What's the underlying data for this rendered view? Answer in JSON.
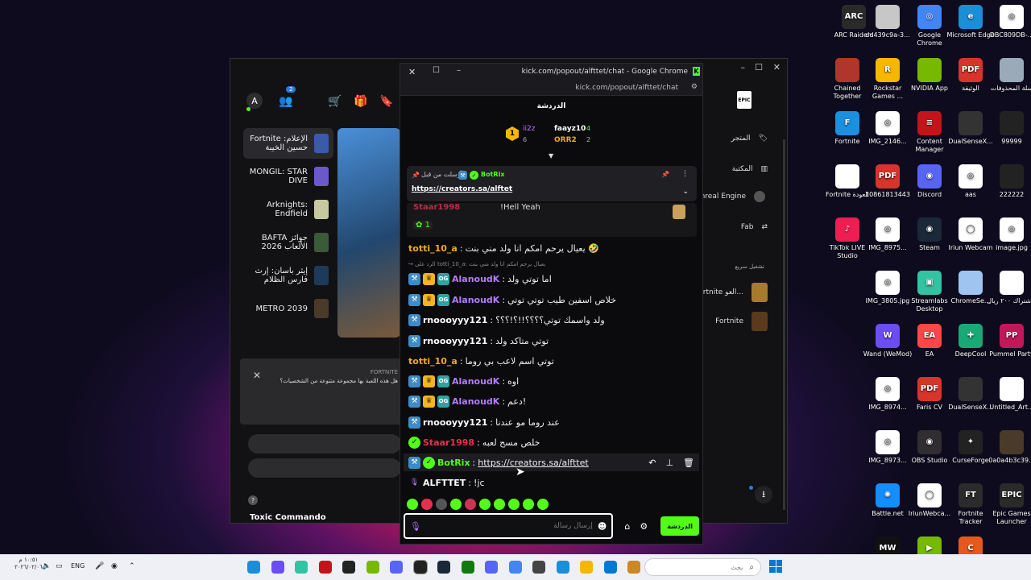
{
  "desktop_icons": [
    {
      "label": "ARC Raiders",
      "color": "#2a2a2a",
      "glyph": "ARC",
      "col": 1029,
      "row": 6
    },
    {
      "label": "dd439c9a-3...",
      "color": "#c7c7c7",
      "glyph": "",
      "col": 1071,
      "row": 6
    },
    {
      "label": "Google Chrome",
      "color": "#4285f4",
      "glyph": "◎",
      "col": 1123,
      "row": 6
    },
    {
      "label": "Microsoft Edge",
      "color": "#1a8fd8",
      "glyph": "e",
      "col": 1174,
      "row": 6
    },
    {
      "label": "DBC809DB-...",
      "color": "#ffffff",
      "glyph": "◎",
      "col": 1225,
      "row": 6
    },
    {
      "label": "Chained Together",
      "color": "#b0352a",
      "glyph": "",
      "col": 1021,
      "row": 72
    },
    {
      "label": "Rockstar Games ...",
      "color": "#f5b700",
      "glyph": "R",
      "col": 1071,
      "row": 72
    },
    {
      "label": "NVIDIA App",
      "color": "#76b900",
      "glyph": "",
      "col": 1123,
      "row": 72
    },
    {
      "label": "الوثيقة",
      "color": "#d9342b",
      "glyph": "PDF",
      "col": 1174,
      "row": 72
    },
    {
      "label": "سلة المحذوفات",
      "color": "#9aaab8",
      "glyph": "",
      "col": 1225,
      "row": 72
    },
    {
      "label": "Fortnite",
      "color": "#1b8fe0",
      "glyph": "F",
      "col": 1021,
      "row": 138
    },
    {
      "label": "IMG_2146...",
      "color": "#ffffff",
      "glyph": "◎",
      "col": 1071,
      "row": 138
    },
    {
      "label": "Content Manager",
      "color": "#c4141b",
      "glyph": "≡",
      "col": 1123,
      "row": 138
    },
    {
      "label": "DualSenseX...",
      "color": "#333333",
      "glyph": "",
      "col": 1174,
      "row": 138
    },
    {
      "label": "99999",
      "color": "#222222",
      "glyph": "",
      "col": 1225,
      "row": 138
    },
    {
      "label": "Fortnite العودة",
      "color": "#ffffff",
      "glyph": "",
      "col": 1021,
      "row": 204
    },
    {
      "label": "10861813443",
      "color": "#d9342b",
      "glyph": "PDF",
      "col": 1071,
      "row": 204
    },
    {
      "label": "Discord",
      "color": "#5865f2",
      "glyph": "◉",
      "col": 1123,
      "row": 204
    },
    {
      "label": "aas",
      "color": "#ffffff",
      "glyph": "◎",
      "col": 1174,
      "row": 204
    },
    {
      "label": "222222",
      "color": "#222222",
      "glyph": "",
      "col": 1225,
      "row": 204
    },
    {
      "label": "TikTok LIVE Studio",
      "color": "#ee1d52",
      "glyph": "♪",
      "col": 1021,
      "row": 270
    },
    {
      "label": "IMG_8975...",
      "color": "#ffffff",
      "glyph": "◎",
      "col": 1071,
      "row": 270
    },
    {
      "label": "Steam",
      "color": "#1b2838",
      "glyph": "◉",
      "col": 1123,
      "row": 270
    },
    {
      "label": "Iriun Webcam",
      "color": "#ffffff",
      "glyph": "◯",
      "col": 1174,
      "row": 270
    },
    {
      "label": "image.jpg",
      "color": "#ffffff",
      "glyph": "◎",
      "col": 1225,
      "row": 270
    },
    {
      "label": "IMG_3805.jpg",
      "color": "#ffffff",
      "glyph": "◎",
      "col": 1071,
      "row": 336
    },
    {
      "label": "Streamlabs Desktop",
      "color": "#31c3a2",
      "glyph": "▣",
      "col": 1123,
      "row": 336
    },
    {
      "label": "ChromeSe...",
      "color": "#9fc4f0",
      "glyph": "",
      "col": 1174,
      "row": 336
    },
    {
      "label": "الاشتراك ٢٠٠ ريال",
      "color": "#ffffff",
      "glyph": "",
      "col": 1225,
      "row": 336
    },
    {
      "label": "Wand (WeMod)",
      "color": "#6c4cf5",
      "glyph": "W",
      "col": 1071,
      "row": 402
    },
    {
      "label": "EA",
      "color": "#ff4747",
      "glyph": "EA",
      "col": 1123,
      "row": 402
    },
    {
      "label": "DeepCool",
      "color": "#19a974",
      "glyph": "✚",
      "col": 1174,
      "row": 402
    },
    {
      "label": "Pummel Party",
      "color": "#c2185b",
      "glyph": "PP",
      "col": 1225,
      "row": 402
    },
    {
      "label": "IMG_8974...",
      "color": "#ffffff",
      "glyph": "◎",
      "col": 1071,
      "row": 468
    },
    {
      "label": "Faris CV",
      "color": "#d9342b",
      "glyph": "PDF",
      "col": 1123,
      "row": 468
    },
    {
      "label": "DualSenseX...",
      "color": "#333333",
      "glyph": "",
      "col": 1174,
      "row": 468
    },
    {
      "label": "Untitled_Art...",
      "color": "#ffffff",
      "glyph": "",
      "col": 1225,
      "row": 468
    },
    {
      "label": "IMG_8973...",
      "color": "#ffffff",
      "glyph": "◎",
      "col": 1071,
      "row": 534
    },
    {
      "label": "OBS Studio",
      "color": "#302e31",
      "glyph": "◉",
      "col": 1123,
      "row": 534
    },
    {
      "label": "CurseForge",
      "color": "#222222",
      "glyph": "✦",
      "col": 1174,
      "row": 534
    },
    {
      "label": "0a0a4b3c39...",
      "color": "#4a3a2a",
      "glyph": "",
      "col": 1225,
      "row": 534
    },
    {
      "label": "Battle.net",
      "color": "#148eff",
      "glyph": "✺",
      "col": 1071,
      "row": 600
    },
    {
      "label": "IriunWebca...",
      "color": "#ffffff",
      "glyph": "◯",
      "col": 1123,
      "row": 600
    },
    {
      "label": "Fortnite Tracker",
      "color": "#2b2b2b",
      "glyph": "FT",
      "col": 1174,
      "row": 600
    },
    {
      "label": "Epic Games Launcher",
      "color": "#2a2a2a",
      "glyph": "EPIC",
      "col": 1225,
      "row": 600
    },
    {
      "label": "",
      "color": "#111111",
      "glyph": "MW",
      "col": 1071,
      "row": 666
    },
    {
      "label": "",
      "color": "#76b900",
      "glyph": "▶",
      "col": 1123,
      "row": 666
    },
    {
      "label": "",
      "color": "#e55a1c",
      "glyph": "C",
      "col": 1174,
      "row": 666
    }
  ],
  "epic": {
    "avatar": "A",
    "friends_count": "2",
    "library": [
      {
        "label": "Fortnite الإعلام: حسين الخيبة",
        "color": "#3b5aa8",
        "selected": true
      },
      {
        "label": "MONGIL: STAR DIVE",
        "color": "#6a5ac8",
        "selected": false
      },
      {
        "label": "Arknights: Endfield",
        "color": "#c9c9a0",
        "selected": false
      },
      {
        "label": "BAFTA جوائز الألعاب 2026",
        "color": "#3a5a3a",
        "selected": false
      },
      {
        "label": "إيثر باسان: إرث فارس الظلام",
        "color": "#1d3a5a",
        "selected": false
      },
      {
        "label": "METRO 2039",
        "color": "#4a3a2a",
        "selected": false
      }
    ],
    "nav": {
      "store": "المتجر",
      "library": "المكتبة",
      "unreal": "Unreal Engine",
      "fab": "Fab",
      "quick_launch": "تشغيل سريع"
    },
    "quick": [
      {
        "label": "Fortnite العو..."
      },
      {
        "label": "Fortnite"
      }
    ],
    "notification": {
      "brand": "FORTNITE",
      "text": "هل هذه اللعبة بها مجموعة متنوعة من الشخصيات؟"
    },
    "bottom_title": "Toxic Commando"
  },
  "chat": {
    "window_title": "kick.com/popout/alfttet/chat - Google Chrome",
    "url": "kick.com/popout/alfttet/chat",
    "header": "الدردشة",
    "leaderboard": [
      {
        "rank": "1",
        "name": "ii2z",
        "score": "6"
      },
      {
        "rank": "",
        "name": "faayz10",
        "score": "4"
      },
      {
        "rank": "",
        "name": "ORR2",
        "score": "2"
      }
    ],
    "pinned": {
      "author": "BotRix",
      "sent_by": "أرسلت من قبل",
      "link": "https://creators.sa/alftet"
    },
    "partial": {
      "name": "Staar1998",
      "text": "!Hell Yeah",
      "count": "1"
    },
    "messages": [
      {
        "badges": [],
        "user": "totti_10_a",
        "color": "#f5a524",
        "text": "يعيال يرحم امكم انا ولد مني بنت 🤣"
      },
      {
        "badges": [],
        "user": "",
        "color": "#888",
        "text": "↪ الرد على totti_10_a: يعيال يرحم امكم انا ولد مني بنت",
        "reply": true
      },
      {
        "badges": [
          "tool",
          "crown",
          "og"
        ],
        "user": "AlanoudK",
        "color": "#b57bff",
        "text": "اما توتي ولد"
      },
      {
        "badges": [
          "tool",
          "crown",
          "og"
        ],
        "user": "AlanoudK",
        "color": "#b57bff",
        "text": "خلاص اسفين طيب توتي توتي"
      },
      {
        "badges": [
          "tool"
        ],
        "user": "rnoooyyy121",
        "color": "#ffffff",
        "text": "ولد واسمك توتي؟؟؟؟!!؟!؟؟؟"
      },
      {
        "badges": [
          "tool"
        ],
        "user": "rnoooyyy121",
        "color": "#ffffff",
        "text": "توتي متاكد ولد"
      },
      {
        "badges": [],
        "user": "totti_10_a",
        "color": "#f5a524",
        "text": "توتي اسم لاعب بي روما"
      },
      {
        "badges": [
          "tool",
          "crown",
          "og"
        ],
        "user": "AlanoudK",
        "color": "#b57bff",
        "text": "اوه"
      },
      {
        "badges": [
          "tool",
          "crown",
          "og"
        ],
        "user": "AlanoudK",
        "color": "#b57bff",
        "text": "دعم!"
      },
      {
        "badges": [
          "tool"
        ],
        "user": "rnoooyyy121",
        "color": "#ffffff",
        "text": "عند روما مو عندنا"
      },
      {
        "badges": [
          "ver"
        ],
        "user": "Staar1998",
        "color": "#e3324f",
        "text": "خلص مسح لعبه"
      },
      {
        "badges": [
          "tool",
          "ver"
        ],
        "user": "BotRix",
        "color": "#53fc18",
        "text": "https://creators.sa/alfttet",
        "link": true,
        "hover": true
      },
      {
        "badges": [
          "mic"
        ],
        "user": "ALFTTET",
        "color": "#ffffff",
        "text": "!jc"
      }
    ],
    "input_placeholder": "إرسال رسالة",
    "send_label": "الدردشة"
  },
  "taskbar": {
    "time": "١٠:٥١ م",
    "date": "٢٠٢٦/٠٢/٠٦",
    "lang": "ENG",
    "search_placeholder": "بحث"
  }
}
